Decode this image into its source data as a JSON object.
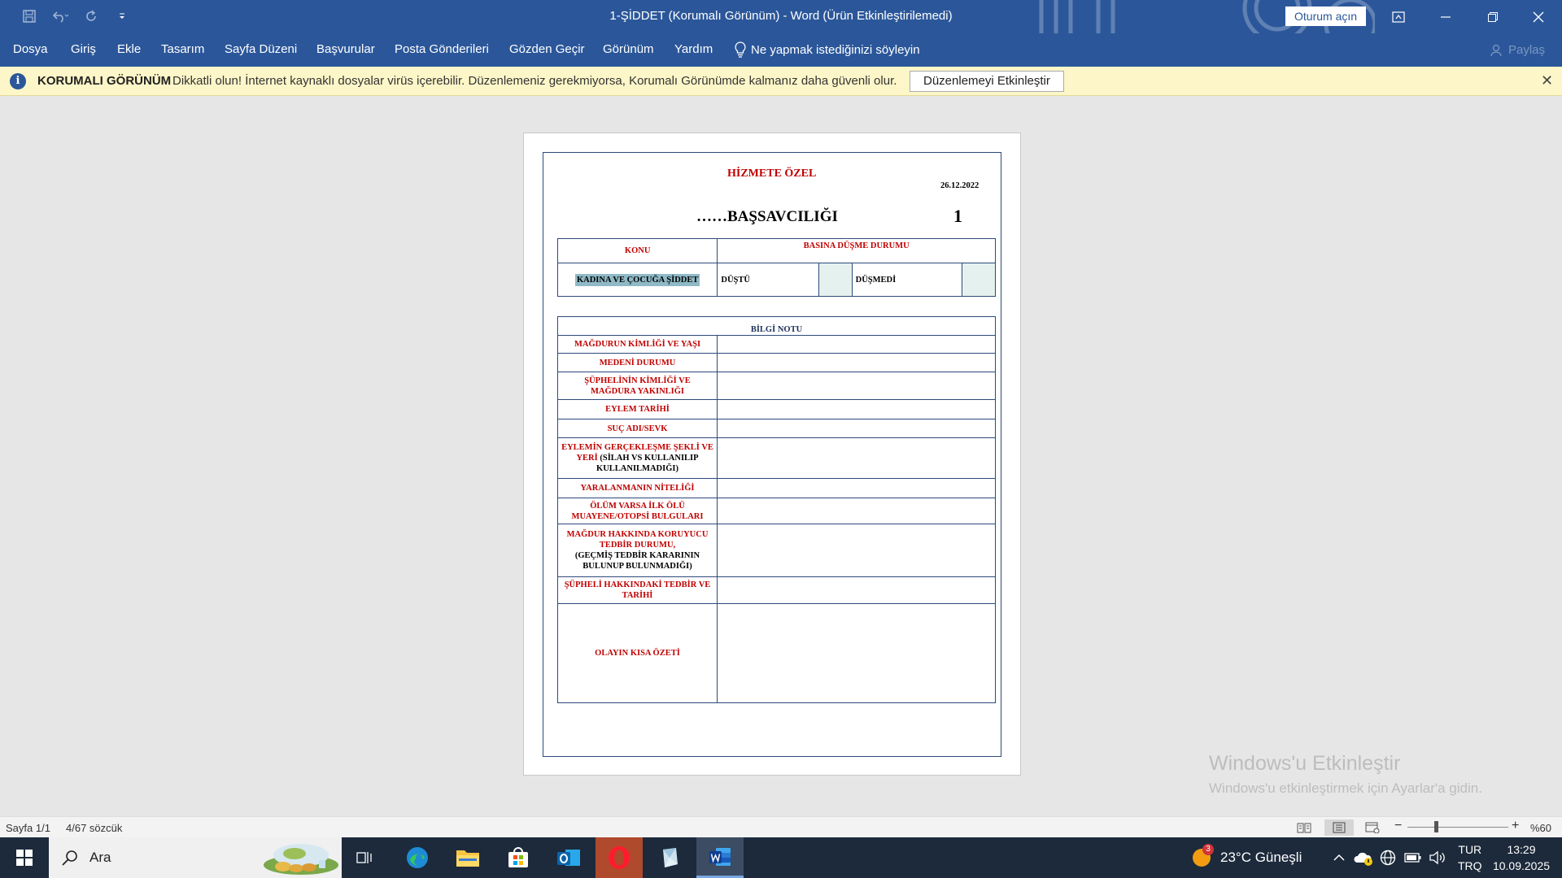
{
  "window": {
    "title": "1-ŞİDDET (Korumalı Görünüm)  -  Word (Ürün Etkinleştirilemedi)",
    "signin_label": "Oturum açın"
  },
  "menu": {
    "items": [
      "Dosya",
      "Giriş",
      "Ekle",
      "Tasarım",
      "Sayfa Düzeni",
      "Başvurular",
      "Posta Gönderileri",
      "Gözden Geçir",
      "Görünüm",
      "Yardım"
    ],
    "tellme": "Ne yapmak istediğinizi söyleyin",
    "share": "Paylaş"
  },
  "protected_bar": {
    "title": "KORUMALI GÖRÜNÜM",
    "message": "Dikkatli olun! İnternet kaynaklı dosyalar virüs içerebilir. Düzenlemeniz gerekmiyorsa, Korumalı Görünümde kalmanız daha güvenli olur.",
    "button": "Düzenlemeyi Etkinleştir"
  },
  "document": {
    "heading": "HİZMETE ÖZEL",
    "date": "26.12.2022",
    "office": "……BAŞSAVCILIĞI",
    "number": "1",
    "konu_label": "KONU",
    "basina_label": "BASINA DÜŞME DURUMU",
    "konu_value": "KADINA VE ÇOCUĞA ŞİDDET",
    "dustu": "DÜŞTÜ",
    "dusmedi": "DÜŞMEDİ",
    "bilgi_notu": "BİLGİ NOTU",
    "rows": [
      {
        "label": "MAĞDURUN KİMLİĞİ VE YAŞI"
      },
      {
        "label": "MEDENİ DURUMU"
      },
      {
        "label": "ŞÜPHELİNİN KİMLİĞİ VE MAĞDURA YAKINLIĞI"
      },
      {
        "label": "EYLEM TARİHİ"
      },
      {
        "label": "SUÇ ADI/SEVK"
      },
      {
        "label": "EYLEMİN GERÇEKLEŞME ŞEKLİ VE YERİ",
        "extra": "(SİLAH VS KULLANILIP KULLANILMADIĞI)"
      },
      {
        "label": "YARALANMANIN NİTELİĞİ"
      },
      {
        "label": "ÖLÜM VARSA İLK ÖLÜ MUAYENE/OTOPSİ BULGULARI"
      },
      {
        "label": "MAĞDUR HAKKINDA KORUYUCU TEDBİR DURUMU,",
        "extra": "(GEÇMİŞ TEDBİR KARARININ BULUNUP BULUNMADIĞI)"
      },
      {
        "label": "ŞÜPHELİ HAKKINDAKİ TEDBİR VE TARİHİ"
      },
      {
        "label": "OLAYIN KISA ÖZETİ"
      }
    ]
  },
  "watermark": {
    "line1": "Windows'u Etkinleştir",
    "line2": "Windows'u etkinleştirmek için Ayarlar'a gidin."
  },
  "status": {
    "page": "Sayfa 1/1",
    "words": "4/67 sözcük",
    "zoom": "%60"
  },
  "taskbar": {
    "search": "Ara",
    "weather": "23°C  Güneşli",
    "weather_badge": "3",
    "lang_top": "TUR",
    "lang_bottom": "TRQ",
    "time": "13:29",
    "date": "10.09.2025"
  }
}
